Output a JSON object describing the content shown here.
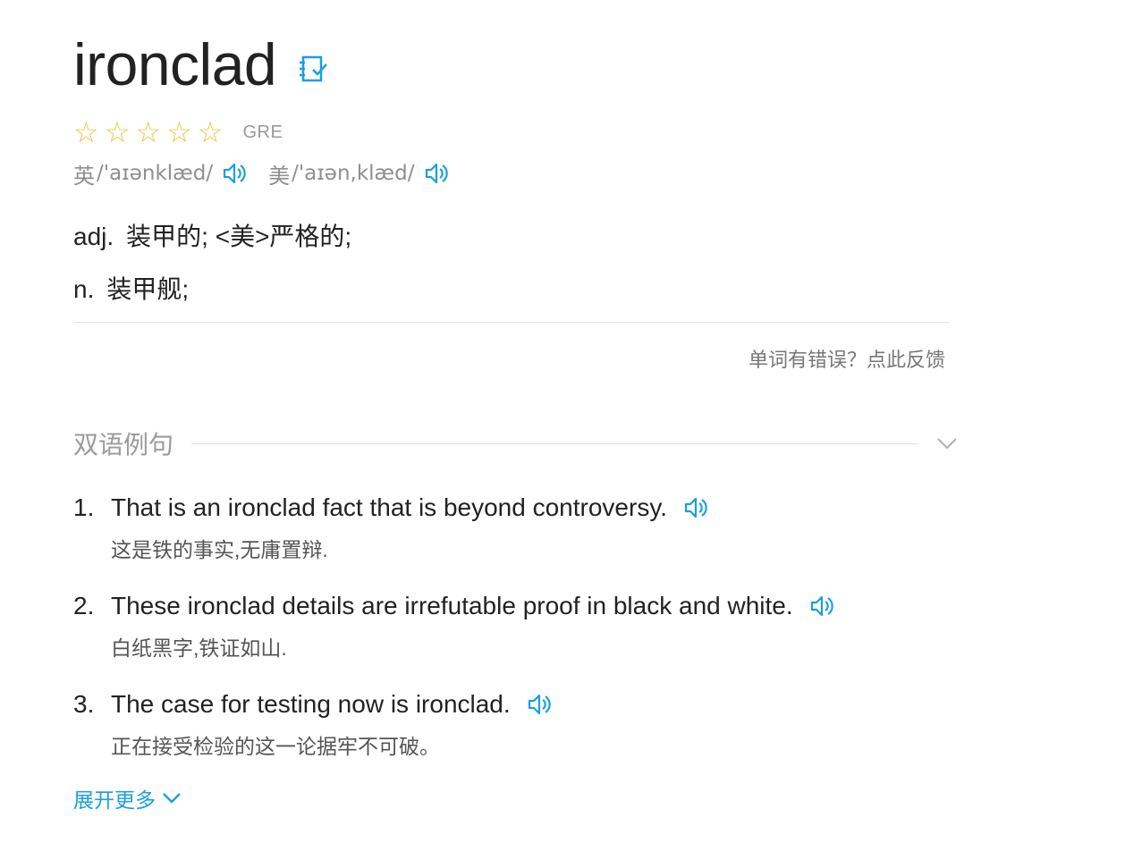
{
  "entry": {
    "word": "ironclad",
    "rating_stars": 5,
    "tag": "GRE"
  },
  "phonetics": {
    "uk_label": "英",
    "uk": "/'aɪənklæd/",
    "us_label": "美",
    "us": "/'aɪən,klæd/"
  },
  "definitions": [
    {
      "pos": "adj.",
      "meaning": "装甲的; <美>严格的;"
    },
    {
      "pos": "n.",
      "meaning": "装甲舰;"
    }
  ],
  "feedback_label": "单词有错误？点此反馈",
  "examples_section": {
    "title": "双语例句",
    "items": [
      {
        "num": "1.",
        "en": "That is an ironclad fact that is beyond controversy.",
        "cn": "这是铁的事实,无庸置辩."
      },
      {
        "num": "2.",
        "en": "These ironclad details are irrefutable proof in black and white.",
        "cn": "白纸黑字,铁证如山."
      },
      {
        "num": "3.",
        "en": "The case for testing now is ironclad.",
        "cn": "正在接受检验的这一论据牢不可破。"
      }
    ],
    "more_label": "展开更多"
  },
  "colors": {
    "accent": "#1a9fe0",
    "star": "#f0c33c"
  }
}
